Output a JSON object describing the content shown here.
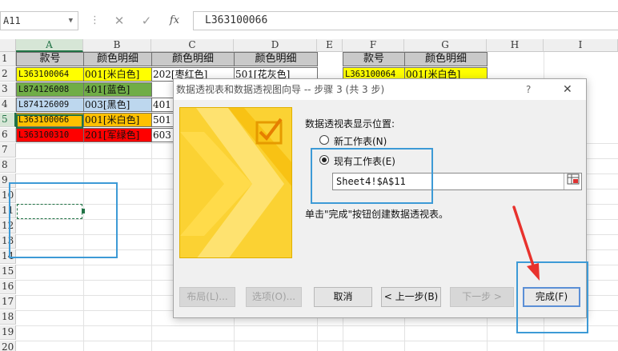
{
  "formula_bar": {
    "name_box": "A11",
    "dropdown_glyph": "▼",
    "separator_glyph": "⋮",
    "cancel_glyph": "✕",
    "confirm_glyph": "✓",
    "fx_label": "fx",
    "formula": "L363100066"
  },
  "columns": [
    "A",
    "B",
    "C",
    "D",
    "E",
    "F",
    "G",
    "H",
    "I"
  ],
  "rows": [
    "1",
    "2",
    "3",
    "4",
    "5",
    "6",
    "7",
    "8",
    "9",
    "10",
    "11",
    "12",
    "13",
    "14",
    "15",
    "16",
    "17",
    "18",
    "19",
    "20"
  ],
  "table_main": {
    "headers": [
      "款号",
      "颜色明细",
      "颜色明细",
      "颜色明细"
    ],
    "rows": [
      {
        "a": "L363100064",
        "b": "001[米白色]",
        "c": "202[枣红色]",
        "d": "501[花灰色]"
      },
      {
        "a": "L874126008",
        "b": "401[蓝色]",
        "c": "",
        "d": ""
      },
      {
        "a": "L874126009",
        "b": "003[黑色]",
        "c": "401",
        "d": ""
      },
      {
        "a": "L363100066",
        "b": "001[米白色]",
        "c": "501",
        "d": ""
      },
      {
        "a": "L363100310",
        "b": "201[军绿色]",
        "c": "603",
        "d": ""
      }
    ]
  },
  "table_side": {
    "headers": [
      "款号",
      "颜色明细"
    ],
    "rows": [
      {
        "f": "L363100064",
        "g": "001[米白色]"
      }
    ]
  },
  "colors": {
    "yellow": "#ffff00",
    "green": "#70ad47",
    "blue": "#bdd7ee",
    "orange": "#ffc000",
    "red": "#ff0000",
    "header_gray": "#c9c9c9",
    "excel_green": "#217346",
    "annotation_blue": "#3d9ad6",
    "arrow_red": "#e8322d"
  },
  "dialog": {
    "title": "数据透视表和数据透视图向导 -- 步骤 3 (共 3 步)",
    "help": "?",
    "close": "✕",
    "prompt": "数据透视表显示位置:",
    "option_new": "新工作表(N)",
    "option_existing": "现有工作表(E)",
    "selected_option": "existing",
    "range_value": "Sheet4!$A$11",
    "range_picker_icon": "range-picker-icon",
    "hint": "单击\"完成\"按钮创建数据透视表。",
    "buttons": {
      "layout": "布局(L)...",
      "options": "选项(O)...",
      "cancel": "取消",
      "back": "< 上一步(B)",
      "next": "下一步 >",
      "finish": "完成(F)"
    }
  }
}
